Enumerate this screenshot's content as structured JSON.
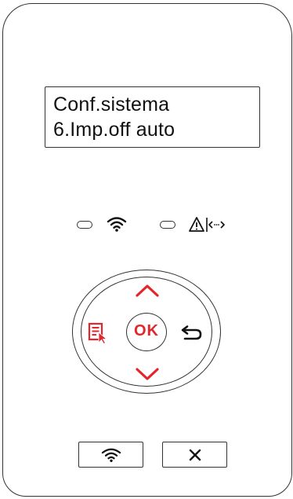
{
  "display": {
    "line1": "Conf.sistema",
    "line2": "6.Imp.off auto"
  },
  "indicators": [
    {
      "name": "wifi-led",
      "icon": "wifi-icon"
    },
    {
      "name": "error-led",
      "icon": "warning-icon"
    }
  ],
  "nav": {
    "ok_label": "OK",
    "up_icon": "chevron-up-icon",
    "down_icon": "chevron-down-icon",
    "menu_icon": "menu-icon",
    "back_icon": "back-icon"
  },
  "buttons": {
    "wifi_icon": "wifi-icon",
    "cancel_icon": "close-icon"
  },
  "colors": {
    "accent": "#e3262b",
    "outline": "#333333"
  }
}
